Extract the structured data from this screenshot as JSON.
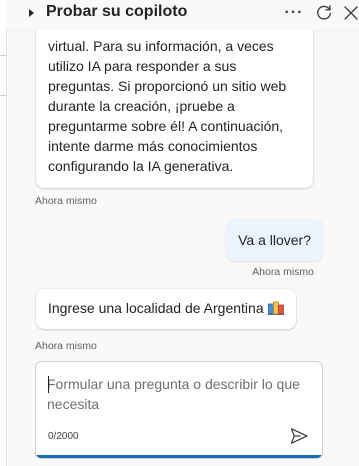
{
  "header": {
    "title": "Probar su copiloto",
    "icons": [
      "chevron-right-icon",
      "more-icon",
      "refresh-icon",
      "close-icon"
    ]
  },
  "messages": [
    {
      "from": "bot",
      "text": "virtual. Para su información, a veces utilizo IA para responder a sus preguntas. Si proporcionó un sitio web durante la creación, ¡pruebe a preguntarme sobre él! A continuación, intente darme más conocimientos configurando la IA generativa.",
      "timestamp": "Ahora mismo"
    },
    {
      "from": "user",
      "text": "Va a llover?",
      "timestamp": "Ahora mismo"
    },
    {
      "from": "bot",
      "text": "Ingrese una localidad de Argentina",
      "icon": "adaptive-card-icon",
      "timestamp": "Ahora mismo"
    }
  ],
  "composer": {
    "placeholder": "Formular una pregunta o describir lo que necesita",
    "value": "",
    "counter": "0/2000",
    "send_icon": "send-icon"
  },
  "colors": {
    "accent": "#0f6cbd",
    "user_bubble": "#ebf3fc",
    "background": "#faf9f8"
  }
}
